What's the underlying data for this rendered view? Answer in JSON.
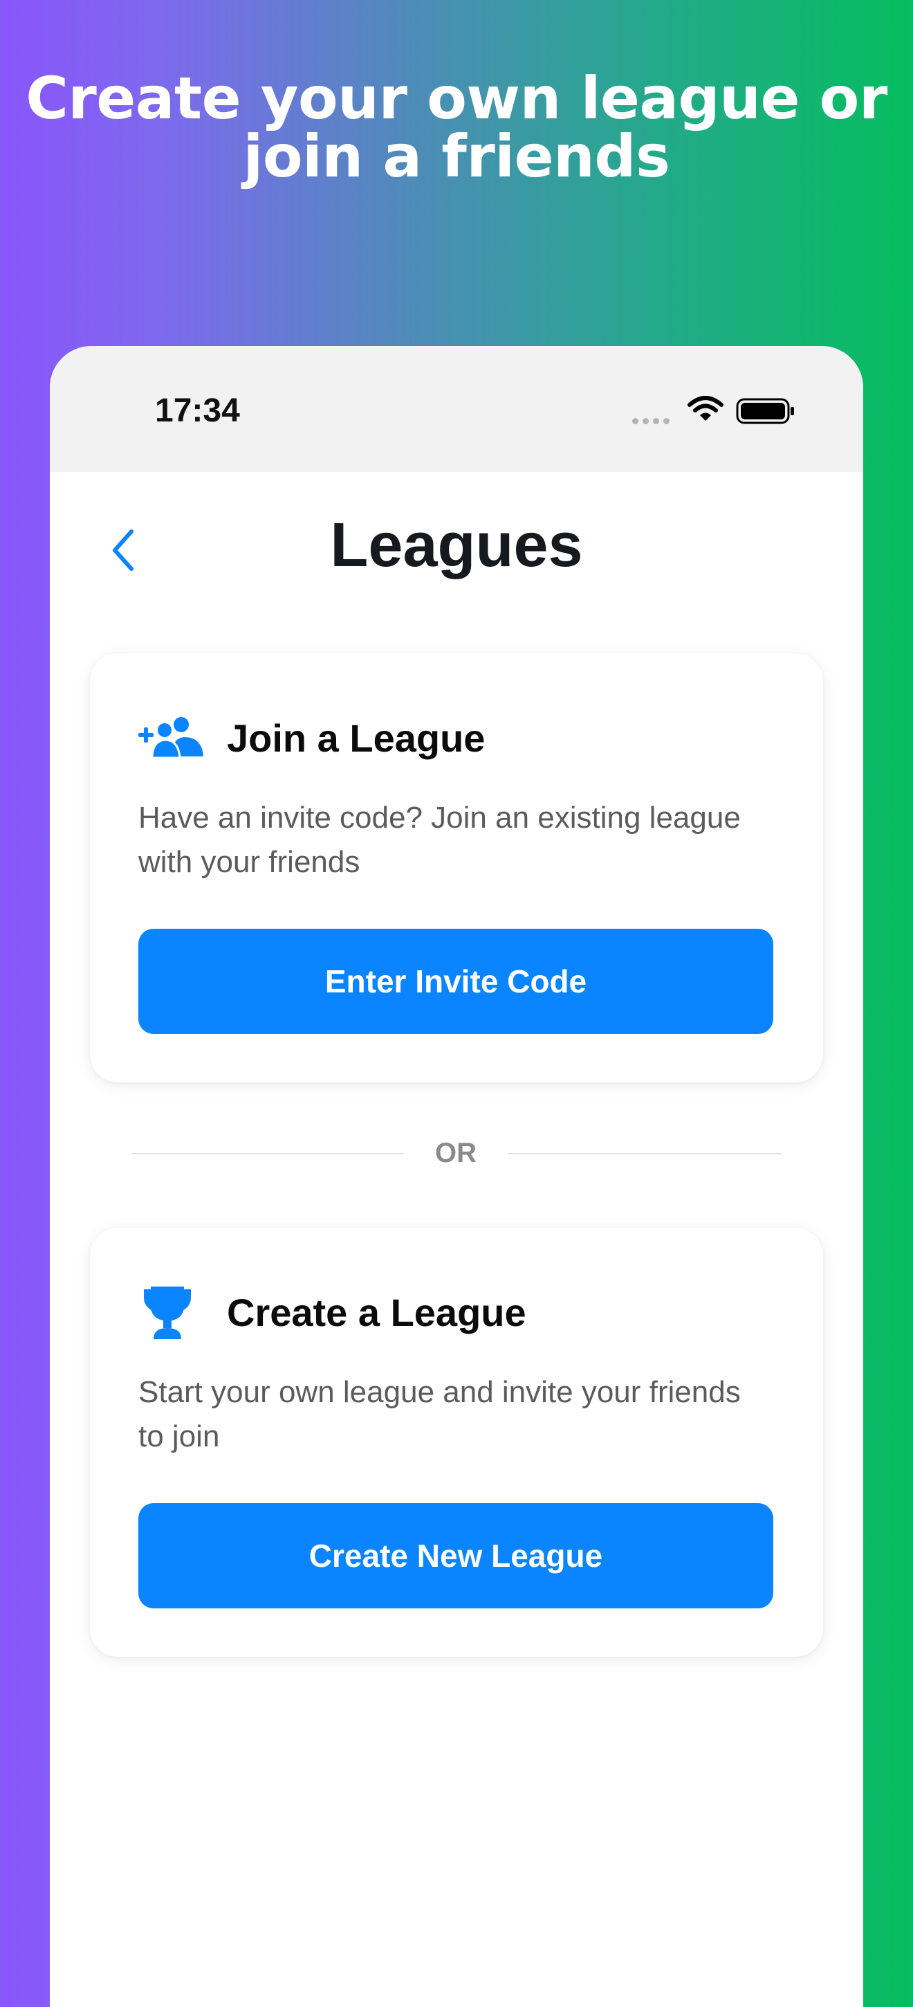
{
  "headline": {
    "line1": "Create your own league or",
    "line2": "join a friends"
  },
  "status_bar": {
    "time": "17:34",
    "icons": [
      "signal-dots-icon",
      "wifi-icon",
      "battery-icon"
    ]
  },
  "nav": {
    "title": "Leagues",
    "back_icon": "chevron-left-icon"
  },
  "join_card": {
    "icon": "person-add-group-icon",
    "title": "Join a League",
    "description": "Have an invite code? Join an existing league with your friends",
    "button_label": "Enter Invite Code"
  },
  "divider": {
    "label": "OR"
  },
  "create_card": {
    "icon": "trophy-icon",
    "title": "Create a League",
    "description": "Start your own league and invite your friends to join",
    "button_label": "Create New League"
  },
  "colors": {
    "accent": "#0a84ff",
    "gradient_start": "#8a55fb",
    "gradient_end": "#06bd5f",
    "title_text": "#16191d",
    "body_text": "#5b5b5b"
  }
}
